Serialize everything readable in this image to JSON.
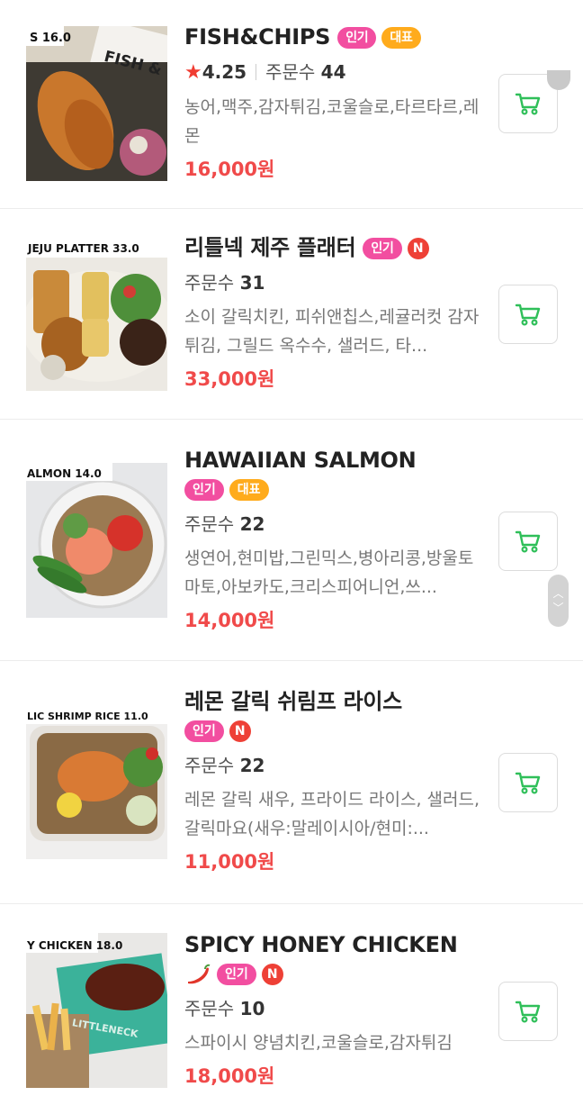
{
  "items": [
    {
      "name": "FISH&CHIPS",
      "badges": [
        "인기",
        "대표"
      ],
      "rating": "4.25",
      "order_label": "주문수",
      "order_count": "44",
      "description": "농어,맥주,감자튀김,코울슬로,타르타르,레몬",
      "price": "16,000원",
      "thumb_label": "S 16.0"
    },
    {
      "name": "리틀넥 제주 플래터",
      "badges": [
        "인기"
      ],
      "new": "N",
      "order_label": "주문수",
      "order_count": "31",
      "description": "소이 갈릭치킨, 피쉬앤칩스,레귤러컷 감자튀김, 그릴드 옥수수, 샐러드, 타...",
      "price": "33,000원",
      "thumb_label": "JEJU PLATTER  33.0"
    },
    {
      "name": "HAWAIIAN SALMON",
      "badges": [
        "인기",
        "대표"
      ],
      "order_label": "주문수",
      "order_count": "22",
      "description": "생연어,현미밥,그린믹스,병아리콩,방울토마토,아보카도,크리스피어니언,쓰...",
      "price": "14,000원",
      "thumb_label": "ALMON 14.0"
    },
    {
      "name": "레몬 갈릭 쉬림프 라이스",
      "badges": [
        "인기"
      ],
      "new": "N",
      "order_label": "주문수",
      "order_count": "22",
      "description": "레몬 갈릭 새우, 프라이드 라이스, 샐러드, 갈릭마요(새우:말레이시아/현미:...",
      "price": "11,000원",
      "thumb_label": "LIC SHRIMP RICE  11.0"
    },
    {
      "name": "SPICY HONEY CHICKEN",
      "badges": [
        "인기"
      ],
      "new": "N",
      "spicy": true,
      "order_label": "주문수",
      "order_count": "10",
      "description": "스파이시 양념치킨,코울슬로,감자튀김",
      "price": "18,000원",
      "thumb_label": "Y CHICKEN 18.0",
      "thumb_label2": "LITTLENECK"
    }
  ],
  "colors": {
    "popular_badge": "#f24ea0",
    "signature_badge": "#ffab1c",
    "new_badge": "#ee4036",
    "price": "#f04a4a",
    "cart_icon": "#2fbf59",
    "star": "#f03c32"
  },
  "icons": {
    "cart": "shopping-cart-icon",
    "star": "star-icon",
    "spicy": "chili-pepper-icon"
  }
}
